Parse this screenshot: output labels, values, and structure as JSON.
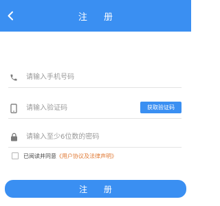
{
  "header": {
    "title": "注 册",
    "back_icon": "chevron-left-icon"
  },
  "colors": {
    "primary": "#3a8ff2",
    "link": "#e07a35",
    "placeholder": "#9a9a9a",
    "divider": "#e3e3e3"
  },
  "form": {
    "phone": {
      "placeholder": "请输入手机号码",
      "value": "",
      "icon": "phone-icon"
    },
    "code": {
      "placeholder": "请输入验证码",
      "value": "",
      "icon": "mobile-device-icon",
      "button_label": "获取验证码"
    },
    "password": {
      "placeholder": "请输入至少6位数的密码",
      "value": "",
      "icon": "lock-icon"
    },
    "agreement": {
      "prefix": "已阅读并同意",
      "link": "《用户协议及法律声明》",
      "checked": false
    },
    "submit_label": "注 册"
  }
}
